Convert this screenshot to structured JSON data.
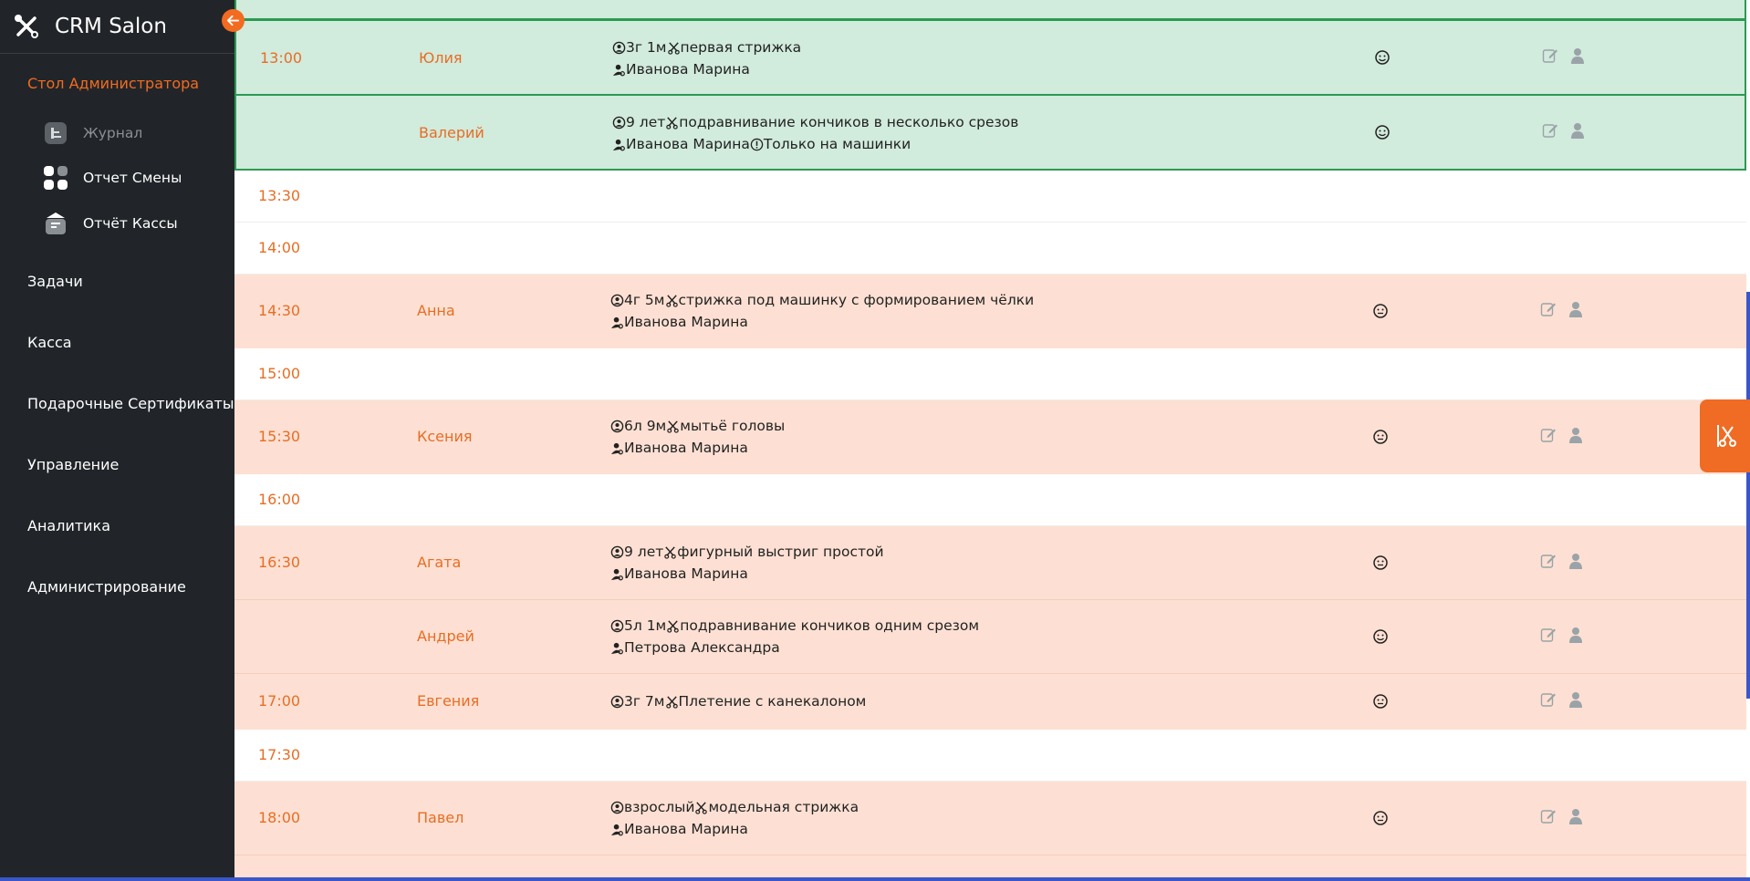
{
  "sidebar": {
    "brand": "CRM Salon",
    "section_title": "Стол Администратора",
    "sub_items": [
      {
        "label": "Журнал",
        "icon": "journal-icon"
      },
      {
        "label": "Отчет Смены",
        "icon": "grid-icon"
      },
      {
        "label": "Отчёт Кассы",
        "icon": "cash-register-icon"
      }
    ],
    "menu": [
      "Задачи",
      "Касса",
      "Подарочные Сертификаты",
      "Управление",
      "Аналитика",
      "Администрирование"
    ]
  },
  "schedule": {
    "rows": [
      {
        "time": "13:00",
        "name": "Юлия",
        "age": "3г 1м",
        "service": "первая стрижка",
        "master": "Иванова Марина",
        "note": ""
      },
      {
        "time": "",
        "name": "Валерий",
        "age": "9 лет",
        "service": "подравнивание кончиков в несколько срезов",
        "master": "Иванова Марина",
        "note": "Только на машинки"
      },
      {
        "time": "13:30"
      },
      {
        "time": "14:00"
      },
      {
        "time": "14:30",
        "name": "Анна",
        "age": "4г 5м",
        "service": "стрижка под машинку с формированием чёлки",
        "master": "Иванова Марина"
      },
      {
        "time": "15:00"
      },
      {
        "time": "15:30",
        "name": "Ксения",
        "age": "6л 9м",
        "service": "мытьё головы",
        "master": "Иванова Марина"
      },
      {
        "time": "16:00"
      },
      {
        "time": "16:30",
        "name": "Агата",
        "age": "9 лет",
        "service": "фигурный выстриг простой",
        "master": "Иванова Марина"
      },
      {
        "time": "",
        "name": "Андрей",
        "age": "5л 1м",
        "service": "подравнивание кончиков одним срезом",
        "master": "Петрова Александра"
      },
      {
        "time": "17:00",
        "name": "Евгения",
        "age": "3г 7м",
        "service": "Плетение с канекалоном"
      },
      {
        "time": "17:30"
      },
      {
        "time": "18:00",
        "name": "Павел",
        "age": "взрослый",
        "service": "модельная стрижка",
        "master": "Иванова Марина"
      }
    ]
  },
  "colors": {
    "accent": "#f26b21",
    "sidebar_bg": "#212529",
    "row_confirmed": "#d1ebdc",
    "row_booked": "#fde0d3",
    "confirmed_border": "#2a9a52"
  }
}
